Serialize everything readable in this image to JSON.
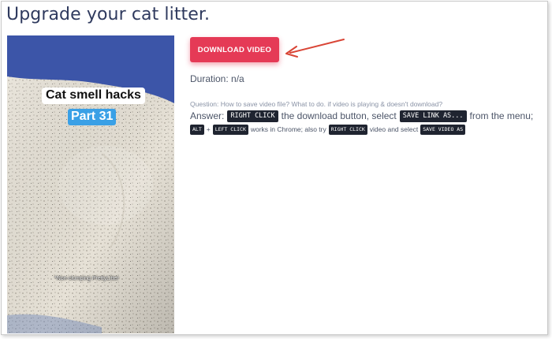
{
  "page": {
    "title": "Upgrade your cat litter."
  },
  "video": {
    "caption_main": "Cat smell hacks",
    "caption_part": "Part 31",
    "caption_small": "*Non-clumping PrettyLitter",
    "colors": {
      "background": "#3c55a8",
      "litter": "#e7e2d8",
      "part_badge": "#3aa0e6"
    }
  },
  "download": {
    "button_label": "DOWNLOAD VIDEO",
    "color": "#e53a56",
    "arrow_color": "#d94536",
    "duration": "Duration: n/a"
  },
  "help": {
    "question": "Question: How to save video file? What to do. if video is playing & doesn't download?",
    "answer_prefix": "Answer:",
    "kbd_right_click": "RIGHT CLICK",
    "text_download_button": "the download button, select",
    "kbd_save_link": "SAVE LINK AS...",
    "text_from_menu": "from the menu;",
    "kbd_alt": "ALT",
    "text_plus": "+",
    "kbd_left_click": "LEFT CLICK",
    "text_works_chrome": "works in Chrome; also try",
    "kbd_right_click_2": "RIGHT CLICK",
    "text_video_select": "video and select",
    "kbd_save_video": "SAVE VIDEO AS"
  }
}
